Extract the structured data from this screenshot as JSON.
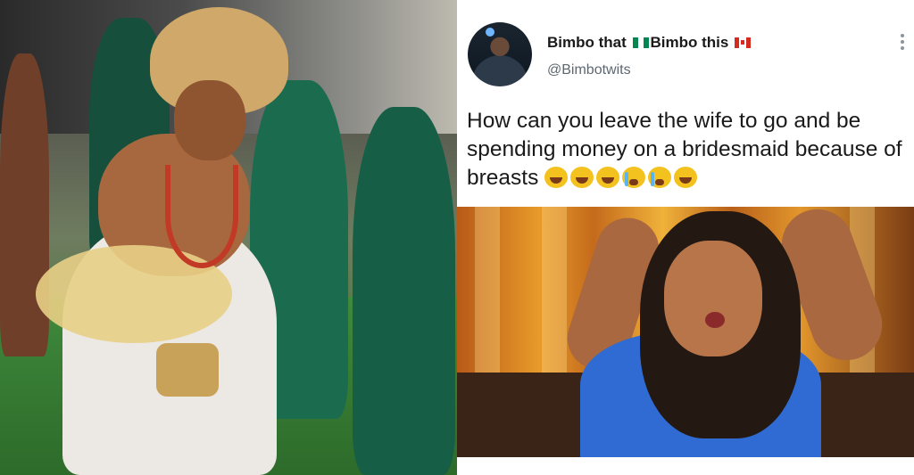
{
  "tweet": {
    "display_name_part1": "Bimbo that",
    "display_name_part2": "Bimbo this",
    "flag_1": "nigeria-flag",
    "flag_2": "canada-flag",
    "handle": "@Bimbotwits",
    "text": "How can you leave the wife to go and be spending money on a bridesmaid because of breasts",
    "emojis": [
      "face-with-tears-of-joy-icon",
      "face-with-tears-of-joy-icon",
      "face-with-tears-of-joy-icon",
      "loudly-crying-face-icon",
      "loudly-crying-face-icon",
      "face-with-tears-of-joy-icon"
    ]
  },
  "images": {
    "left": "wedding-photo",
    "bottom_right": "reaction-photo"
  },
  "colors": {
    "text": "#1a1a1a",
    "handle": "#5c6770"
  }
}
